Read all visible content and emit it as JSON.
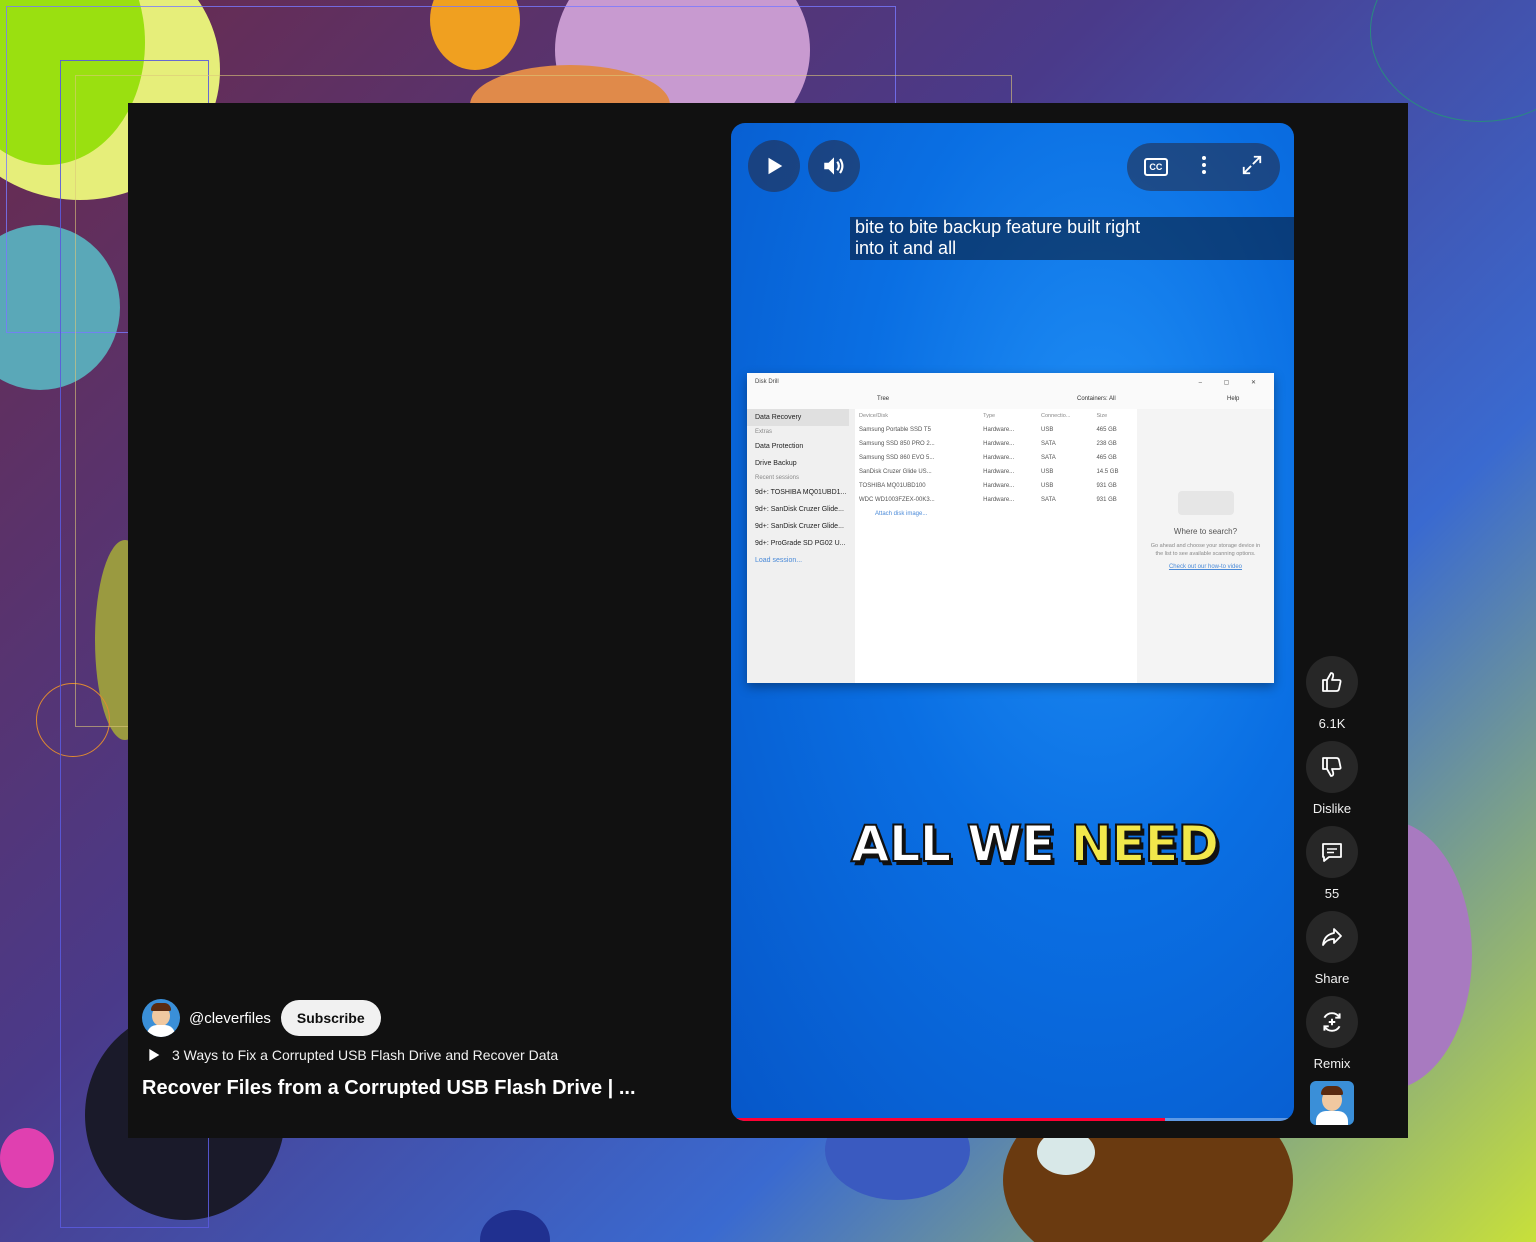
{
  "video": {
    "caption_line1": "bite to bite backup feature built right",
    "caption_line2": "into it and all",
    "overlay_text_white": "ALL WE ",
    "overlay_text_yellow": "NEED",
    "progress": 0.77
  },
  "controls": {
    "play_icon": "play-icon",
    "volume_icon": "volume-icon",
    "cc_label": "CC",
    "more_icon": "more-vert-icon",
    "fullscreen_icon": "fullscreen-icon"
  },
  "app_screenshot": {
    "title": "Disk Drill",
    "toolbar_view": "Tree",
    "toolbar_containers": "Containers: All",
    "toolbar_help": "Help",
    "sidebar": {
      "data_recovery": "Data Recovery",
      "extras_head": "Extras",
      "data_protection": "Data Protection",
      "drive_backup": "Drive Backup",
      "recent_head": "Recent sessions",
      "sessions": [
        "9d+: TOSHIBA MQ01UBD1...",
        "9d+: SanDisk Cruzer Glide...",
        "9d+: SanDisk Cruzer Glide...",
        "9d+: ProGrade SD PG02 U..."
      ],
      "load_session": "Load session..."
    },
    "table_headers": [
      "Device/Disk",
      "Type",
      "Connectio...",
      "Size"
    ],
    "rows": [
      [
        "Samsung Portable SSD T5",
        "Hardware...",
        "USB",
        "465 GB"
      ],
      [
        "Samsung SSD 850 PRO 2...",
        "Hardware...",
        "SATA",
        "238 GB"
      ],
      [
        "Samsung SSD 860 EVO 5...",
        "Hardware...",
        "SATA",
        "465 GB"
      ],
      [
        "SanDisk Cruzer Glide US...",
        "Hardware...",
        "USB",
        "14.5 GB"
      ],
      [
        "TOSHIBA MQ01UBD100",
        "Hardware...",
        "USB",
        "931 GB"
      ],
      [
        "WDC WD1003FZEX-00K3...",
        "Hardware...",
        "SATA",
        "931 GB"
      ]
    ],
    "attach_disk": "Attach disk image...",
    "right_title": "Where to search?",
    "right_desc": "Go ahead and choose your storage device in the list to see available scanning options.",
    "right_link": "Check out our how-to video"
  },
  "rail": {
    "like_count": "6.1K",
    "dislike_label": "Dislike",
    "comments_count": "55",
    "share_label": "Share",
    "remix_label": "Remix"
  },
  "channel": {
    "handle": "@cleverfiles",
    "subscribe_label": "Subscribe",
    "playlist_title": "3 Ways to Fix a Corrupted USB Flash Drive and Recover Data",
    "video_title": "Recover Files from a Corrupted USB Flash Drive | ..."
  },
  "colors": {
    "accent_red": "#ff0033",
    "highlight_yellow": "#f2e84b"
  }
}
